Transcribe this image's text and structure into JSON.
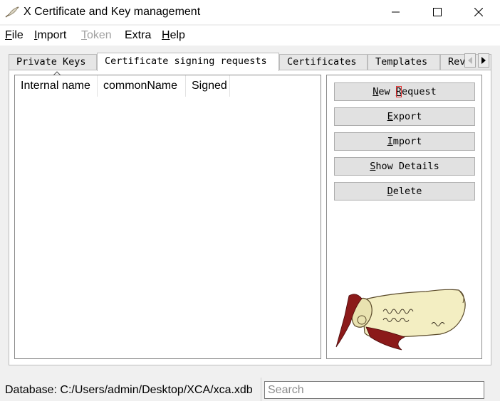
{
  "window": {
    "title": "X Certificate and Key management",
    "icon": "xca-feather-icon"
  },
  "menu": {
    "file": {
      "first": "F",
      "rest": "ile"
    },
    "import": {
      "first": "I",
      "rest": "mport"
    },
    "token": {
      "first": "T",
      "rest": "oken"
    },
    "extra": {
      "label": "Extra"
    },
    "help": {
      "first": "H",
      "rest": "elp"
    }
  },
  "tabs": [
    {
      "label": "Private Keys",
      "active": false
    },
    {
      "label": "Certificate signing requests",
      "active": true
    },
    {
      "label": "Certificates",
      "active": false
    },
    {
      "label": "Templates",
      "active": false
    },
    {
      "label": "Rev",
      "active": false
    }
  ],
  "list": {
    "columns": [
      "Internal name",
      "commonName",
      "Signed"
    ],
    "rows": []
  },
  "buttons": {
    "new_request": {
      "a": "N",
      "b": "ew ",
      "c": "R",
      "d": "equest"
    },
    "export": {
      "a": "E",
      "b": "xport"
    },
    "import": {
      "a": "I",
      "b": "mport"
    },
    "show_details": {
      "a": "S",
      "b": "how Details"
    },
    "delete": {
      "a": "D",
      "b": "elete"
    }
  },
  "status": {
    "database_label": "Database: C:/Users/admin/Desktop/XCA/xca.xdb",
    "search_placeholder": "Search",
    "search_value": ""
  },
  "colors": {
    "accent_red": "#e03030",
    "scroll_parchment": "#f3eec2",
    "ribbon": "#8b1a1a"
  }
}
